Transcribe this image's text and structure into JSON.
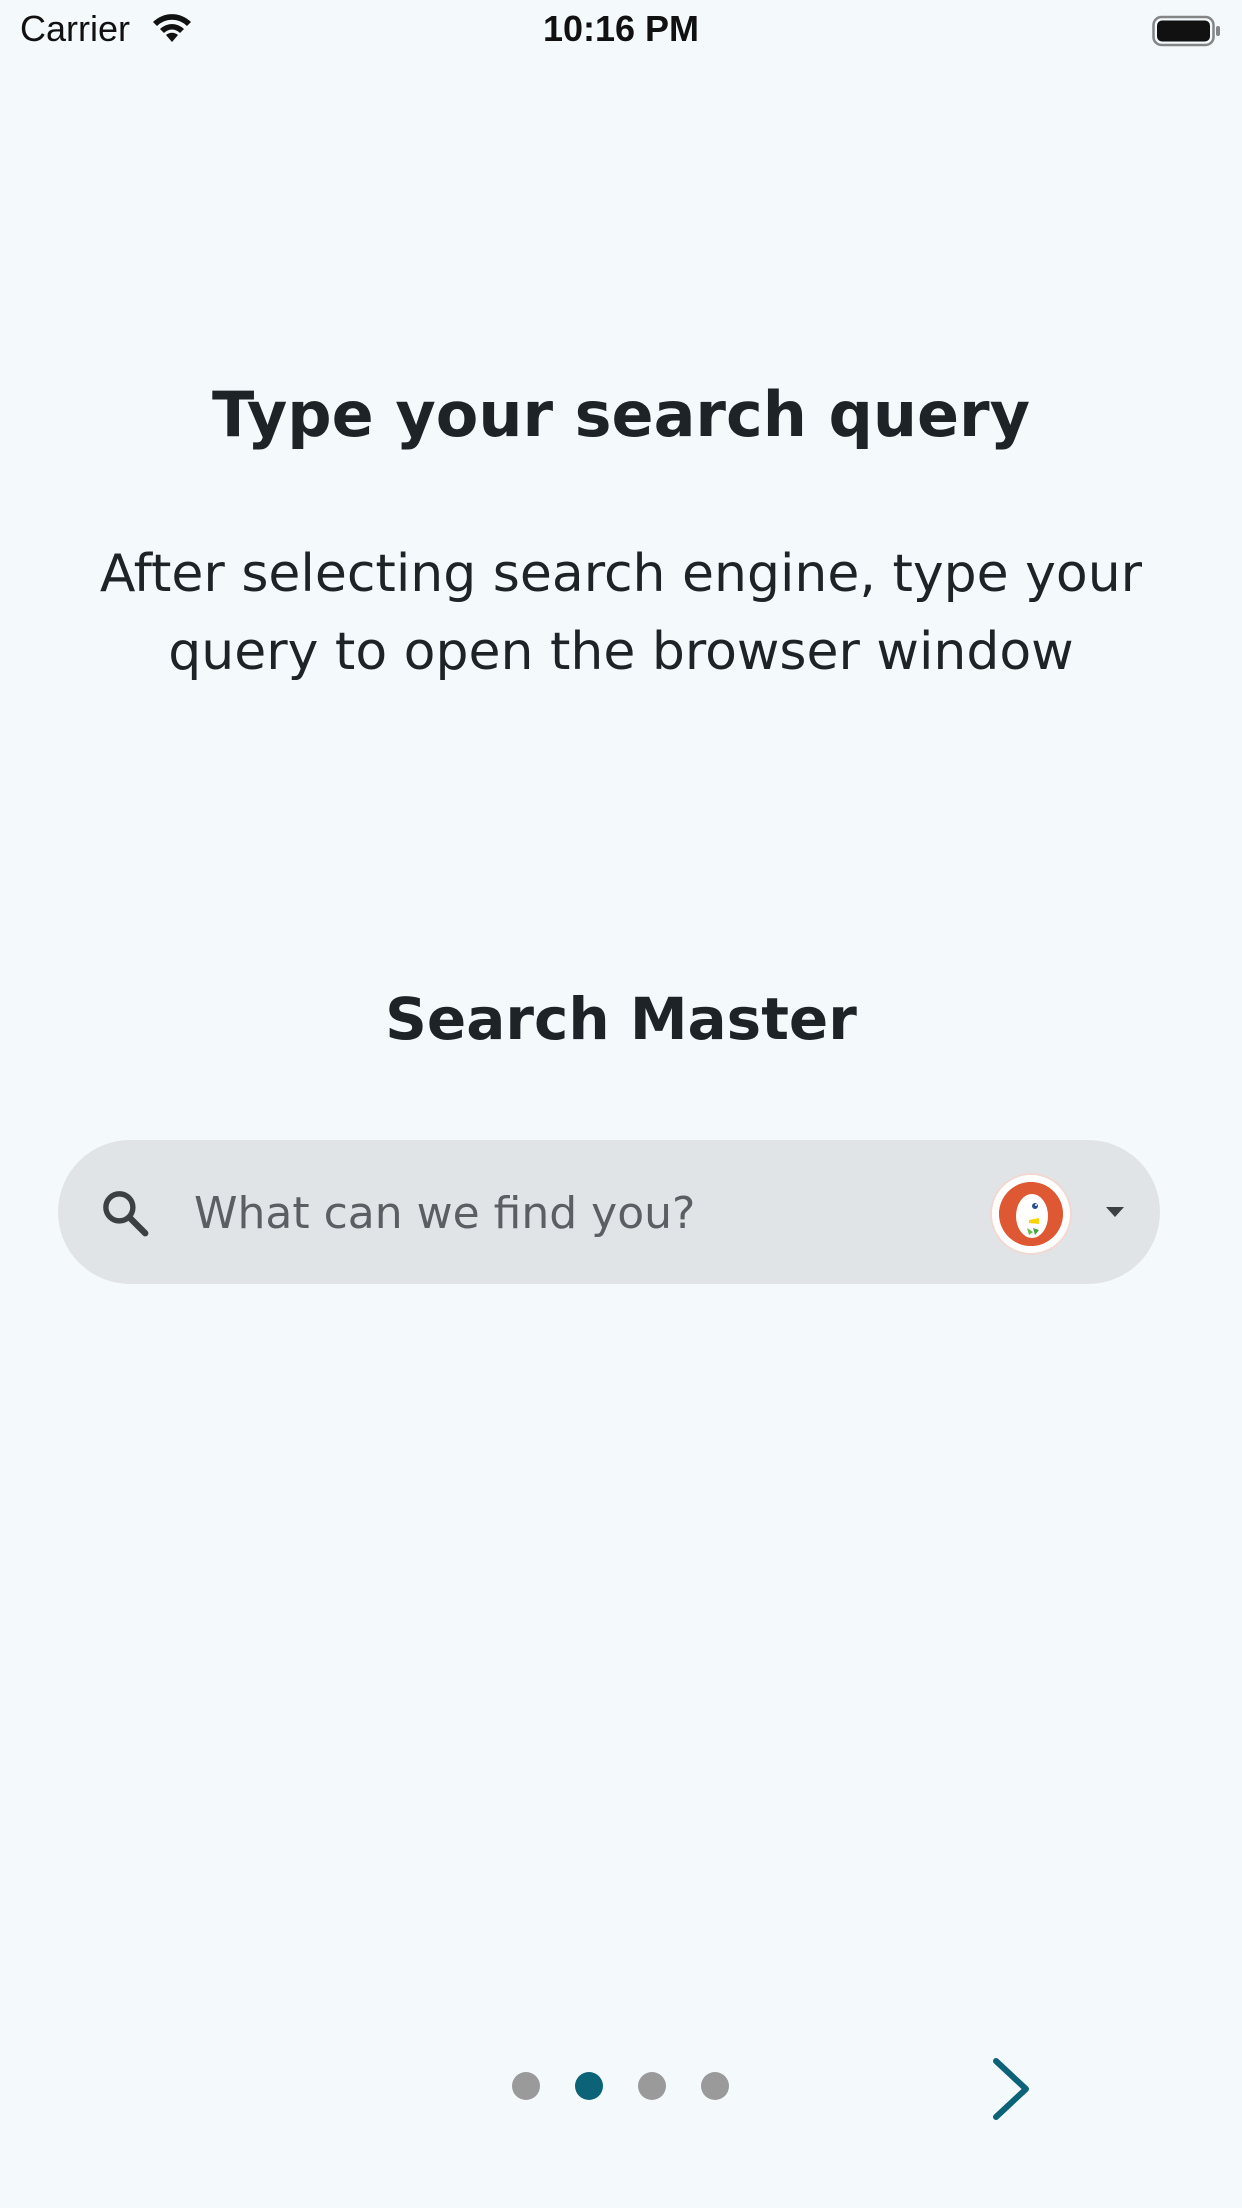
{
  "status_bar": {
    "carrier": "Carrier",
    "time": "10:16 PM"
  },
  "onboarding": {
    "title": "Type your search query",
    "description": "After selecting search engine, type your query to open the browser window"
  },
  "preview": {
    "app_title": "Search Master",
    "search": {
      "placeholder": "What can we find you?",
      "value": ""
    },
    "selected_engine_icon": "duckduckgo-icon"
  },
  "pager": {
    "total": 4,
    "current_index": 1
  },
  "colors": {
    "background": "#f4f9fc",
    "accent": "#0c6277",
    "search_bar": "#e1e4e7",
    "dot_inactive": "#9a9a9a"
  }
}
